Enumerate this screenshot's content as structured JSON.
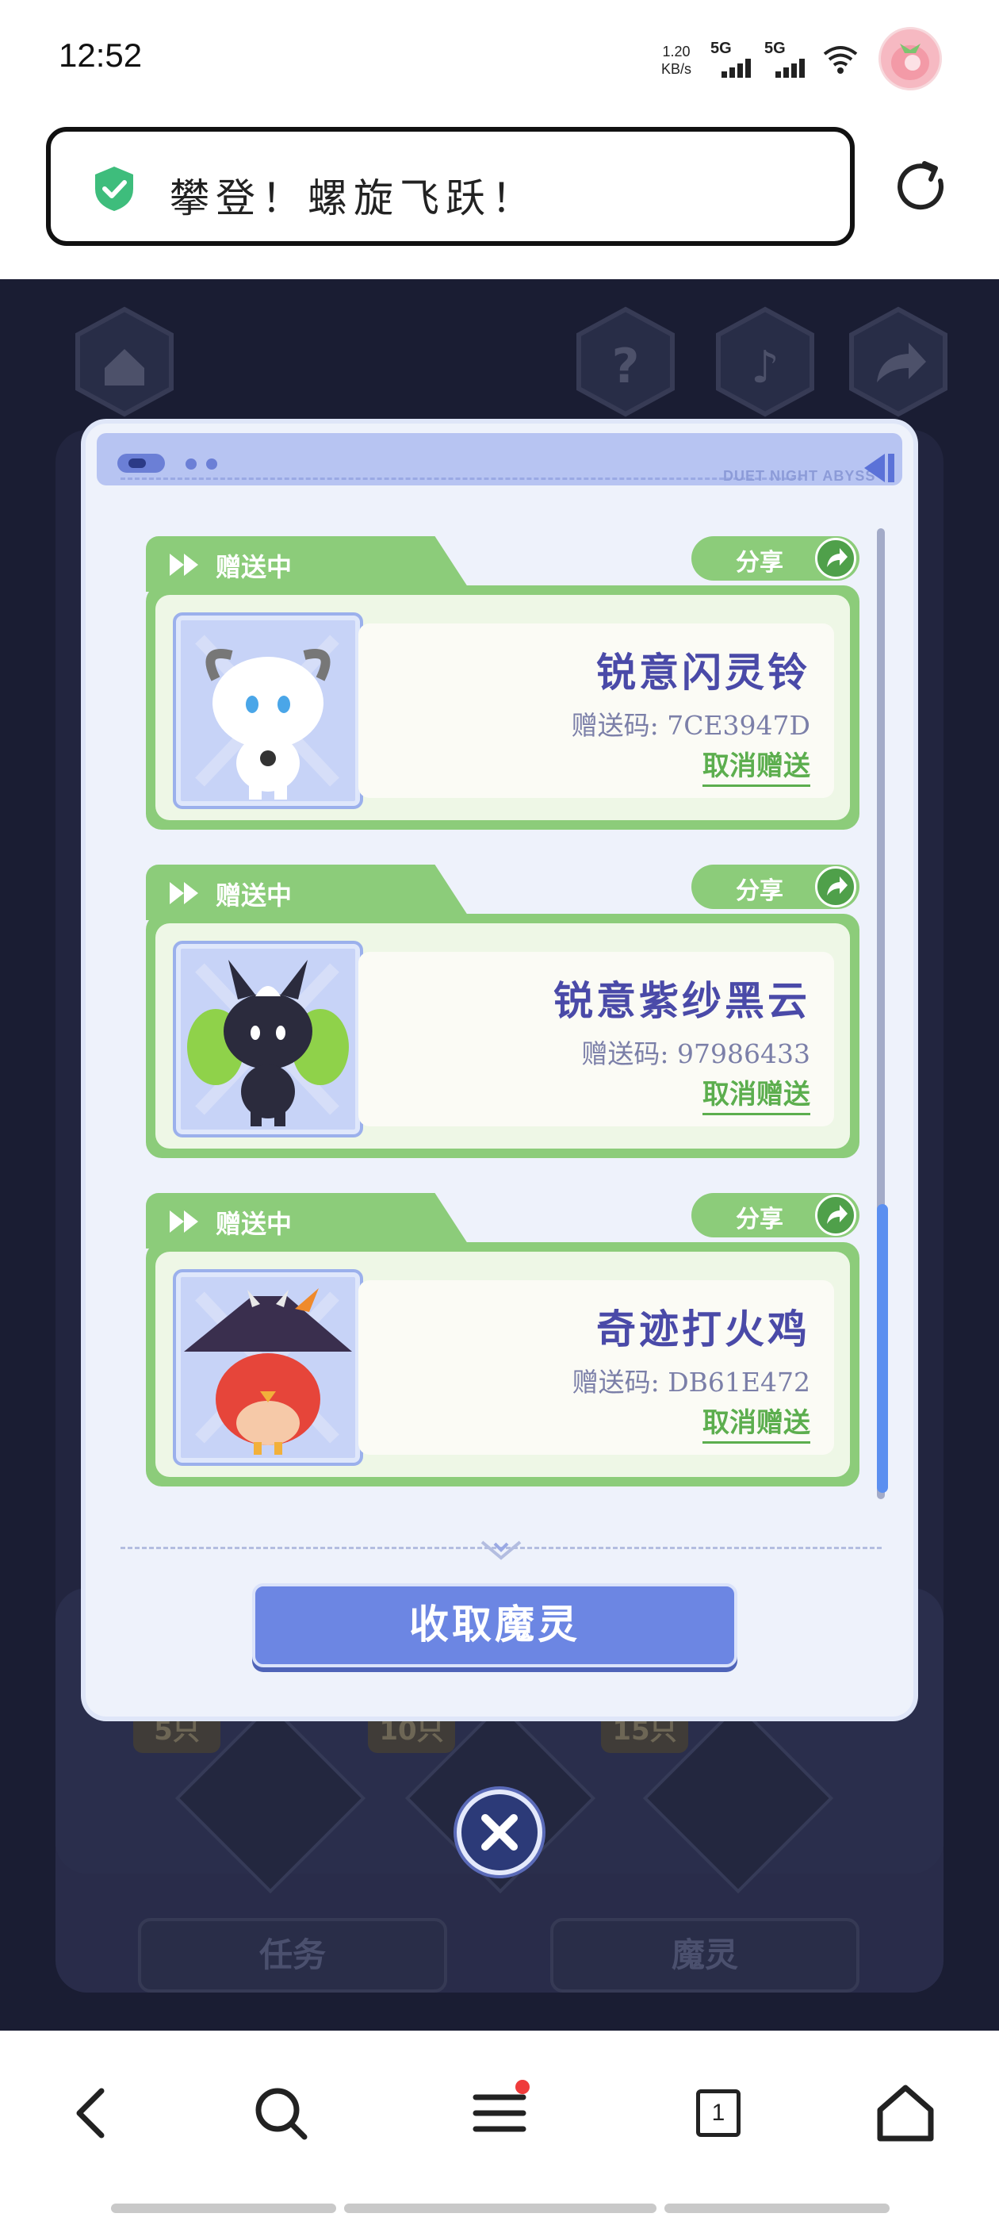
{
  "status_bar": {
    "time": "12:52",
    "net_speed_value": "1.20",
    "net_speed_unit": "KB/s",
    "sim1_label": "5G",
    "sim2_label": "5G",
    "icons": [
      "signal-bars-icon",
      "wifi-icon",
      "avatar"
    ]
  },
  "url_bar": {
    "title": "攀登！螺旋飞跃！",
    "security_icon": "shield-check-icon",
    "reload_icon": "reload-icon"
  },
  "dialog": {
    "header_brand": "DUET NIGHT ABYSS",
    "items": [
      {
        "status": "赠送中",
        "share_label": "分享",
        "name": "锐意闪灵铃",
        "code": "赠送码: 7CE3947D",
        "cancel_label": "取消赠送",
        "portrait": "white-goat-spirit"
      },
      {
        "status": "赠送中",
        "share_label": "分享",
        "name": "锐意紫纱黑云",
        "code": "赠送码: 97986433",
        "cancel_label": "取消赠送",
        "portrait": "dark-leaf-spirit"
      },
      {
        "status": "赠送中",
        "share_label": "分享",
        "name": "奇迹打火鸡",
        "code": "赠送码: DB61E472",
        "cancel_label": "取消赠送",
        "portrait": "red-bird-witch-hat"
      }
    ],
    "collect_button": "收取魔灵"
  },
  "background": {
    "badges": [
      "5只",
      "10只",
      "15只"
    ],
    "tabs": [
      "任务",
      "魔灵"
    ]
  },
  "bottom_nav": {
    "tab_count": "1",
    "icons": [
      "back-icon",
      "search-icon",
      "menu-icon",
      "tabs-icon",
      "home-icon"
    ]
  },
  "colors": {
    "card_green": "#8ccc7a",
    "dialog_bg": "#eef2fb",
    "button_blue": "#6c86e3",
    "name_purple": "#4a4aa8"
  }
}
